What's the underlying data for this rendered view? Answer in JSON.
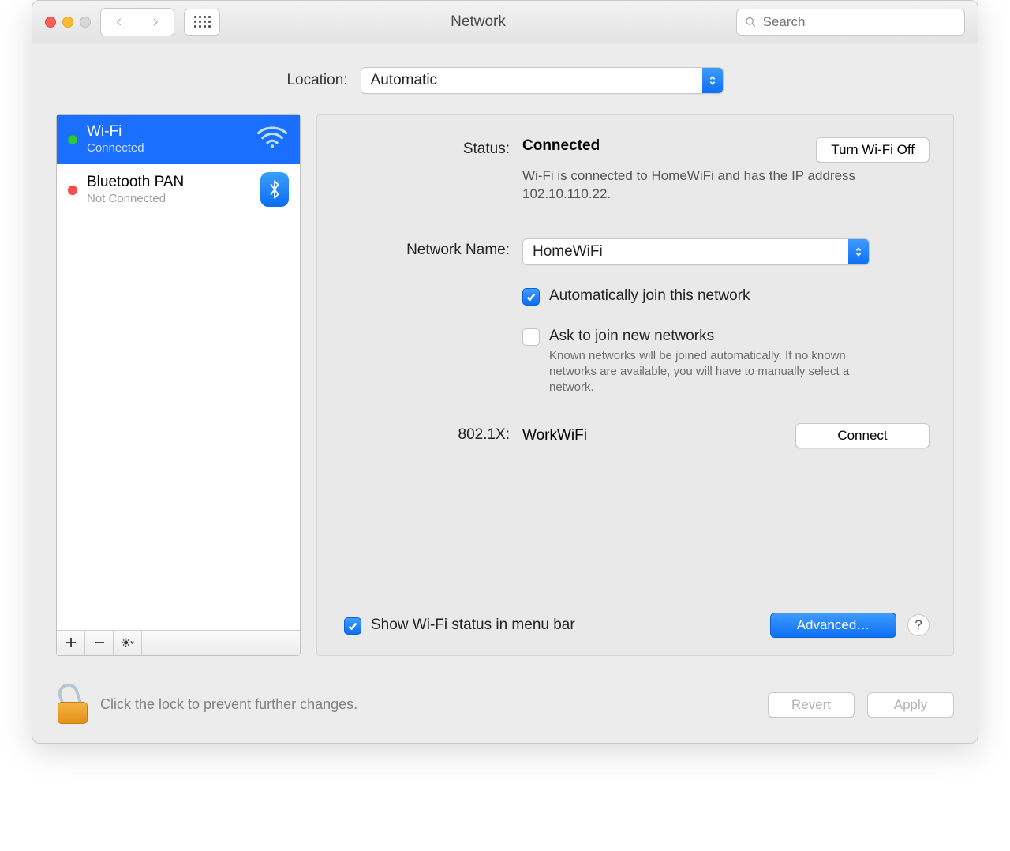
{
  "window": {
    "title": "Network"
  },
  "search": {
    "placeholder": "Search"
  },
  "location": {
    "label": "Location:",
    "value": "Automatic"
  },
  "sidebar": {
    "services": [
      {
        "name": "Wi-Fi",
        "status": "Connected",
        "dot": "green",
        "icon": "wifi",
        "selected": true
      },
      {
        "name": "Bluetooth PAN",
        "status": "Not Connected",
        "dot": "red",
        "icon": "bluetooth",
        "selected": false
      }
    ]
  },
  "main": {
    "status_label": "Status:",
    "status_value": "Connected",
    "turn_off_button": "Turn Wi-Fi Off",
    "status_desc": "Wi-Fi is connected to HomeWiFi and has the IP address 102.10.110.22.",
    "network_name_label": "Network Name:",
    "network_name_value": "HomeWiFi",
    "auto_join_label": "Automatically join this network",
    "ask_join_label": "Ask to join new networks",
    "ask_join_help": "Known networks will be joined automatically. If no known networks are available, you will have to manually select a network.",
    "x8021_label": "802.1X:",
    "x8021_value": "WorkWiFi",
    "connect_button": "Connect",
    "show_menu_label": "Show Wi-Fi status in menu bar",
    "advanced_button": "Advanced…",
    "help": "?"
  },
  "footer": {
    "lock_text": "Click the lock to prevent further changes.",
    "revert": "Revert",
    "apply": "Apply"
  }
}
